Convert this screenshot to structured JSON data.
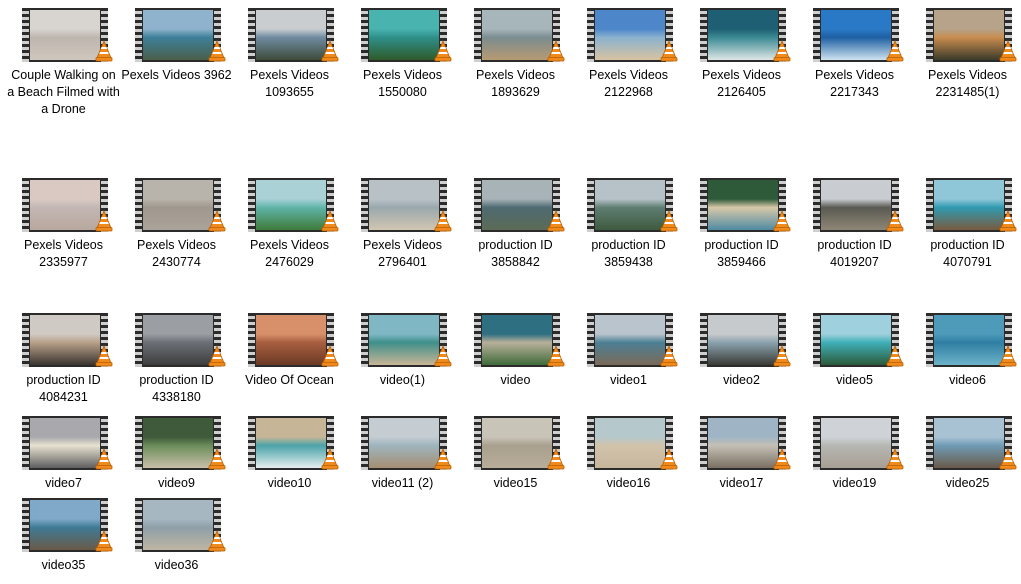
{
  "files": [
    {
      "name": "Couple Walking on a Beach Filmed with a Drone",
      "icon": "video-file-icon",
      "sky": "#d8d4cf",
      "mid": "#bdb6ae",
      "ground": "#cfc7bd"
    },
    {
      "name": "Pexels Videos 3962",
      "icon": "video-file-icon",
      "sky": "#8fb3cc",
      "mid": "#3d7f99",
      "ground": "#4a5f4a"
    },
    {
      "name": "Pexels Videos 1093655",
      "icon": "video-file-icon",
      "sky": "#c9cdd0",
      "mid": "#6f8aa0",
      "ground": "#3e4b3a"
    },
    {
      "name": "Pexels Videos 1550080",
      "icon": "video-file-icon",
      "sky": "#49b3b0",
      "mid": "#2f8f8a",
      "ground": "#2f5a2a"
    },
    {
      "name": "Pexels Videos 1893629",
      "icon": "video-file-icon",
      "sky": "#a7b6bb",
      "mid": "#7b8c90",
      "ground": "#b79a72"
    },
    {
      "name": "Pexels Videos 2122968",
      "icon": "video-file-icon",
      "sky": "#4d86c9",
      "mid": "#8ab2cf",
      "ground": "#d8c3a0"
    },
    {
      "name": "Pexels Videos 2126405",
      "icon": "video-file-icon",
      "sky": "#1f5f73",
      "mid": "#3b8a93",
      "ground": "#dfe6e6"
    },
    {
      "name": "Pexels Videos 2217343",
      "icon": "video-file-icon",
      "sky": "#2a79c6",
      "mid": "#1e5fa3",
      "ground": "#cfe3f0"
    },
    {
      "name": "Pexels Videos 2231485(1)",
      "icon": "video-file-icon",
      "sky": "#b6a38a",
      "mid": "#c88c4e",
      "ground": "#3b3a2a"
    },
    {
      "name": "Pexels Videos 2335977",
      "icon": "video-file-icon",
      "sky": "#d9c9c2",
      "mid": "#c3b7b4",
      "ground": "#b8a79e"
    },
    {
      "name": "Pexels Videos 2430774",
      "icon": "video-file-icon",
      "sky": "#b9b4ab",
      "mid": "#9f988e",
      "ground": "#aaa39a"
    },
    {
      "name": "Pexels Videos 2476029",
      "icon": "video-file-icon",
      "sky": "#a9d1d6",
      "mid": "#5fb4a8",
      "ground": "#3f7a3a"
    },
    {
      "name": "Pexels Videos 2796401",
      "icon": "video-file-icon",
      "sky": "#b8c2c6",
      "mid": "#9aa8ad",
      "ground": "#d2c6b2"
    },
    {
      "name": "production ID 3858842",
      "icon": "video-file-icon",
      "sky": "#a8b3b8",
      "mid": "#4e6a72",
      "ground": "#5b6b55"
    },
    {
      "name": "production ID 3859438",
      "icon": "video-file-icon",
      "sky": "#b6c2c8",
      "mid": "#5e7e72",
      "ground": "#3e5a3e"
    },
    {
      "name": "production ID 3859466",
      "icon": "video-file-icon",
      "sky": "#2e5a3a",
      "mid": "#d7c8a8",
      "ground": "#4f8aa3"
    },
    {
      "name": "production ID 4019207",
      "icon": "video-file-icon",
      "sky": "#c9ccd0",
      "mid": "#5a5a52",
      "ground": "#8f8676"
    },
    {
      "name": "production ID 4070791",
      "icon": "video-file-icon",
      "sky": "#8fc7d8",
      "mid": "#2f9ab0",
      "ground": "#7a5a3e"
    },
    {
      "name": "production ID 4084231",
      "icon": "video-file-icon",
      "sky": "#cfcbc4",
      "mid": "#b8a089",
      "ground": "#3a3530"
    },
    {
      "name": "production ID 4338180",
      "icon": "video-file-icon",
      "sky": "#9b9ea3",
      "mid": "#6b6f75",
      "ground": "#3d3d3d"
    },
    {
      "name": "Video Of Ocean",
      "icon": "video-file-icon",
      "sky": "#d8906a",
      "mid": "#a85e3f",
      "ground": "#6b3a26"
    },
    {
      "name": "video(1)",
      "icon": "video-file-icon",
      "sky": "#7fb8c4",
      "mid": "#3e8f8a",
      "ground": "#c8b596"
    },
    {
      "name": "video",
      "icon": "video-file-icon",
      "sky": "#2e6f82",
      "mid": "#b9b09a",
      "ground": "#3f6b3a"
    },
    {
      "name": "video1",
      "icon": "video-file-icon",
      "sky": "#b9c4cc",
      "mid": "#4c7f95",
      "ground": "#7a6a58"
    },
    {
      "name": "video2",
      "icon": "video-file-icon",
      "sky": "#c7cacc",
      "mid": "#8aa2ae",
      "ground": "#3b3b36"
    },
    {
      "name": "video5",
      "icon": "video-file-icon",
      "sky": "#9fd0dd",
      "mid": "#3fb0b8",
      "ground": "#2c5a3a"
    },
    {
      "name": "video6",
      "icon": "video-file-icon",
      "sky": "#4d9ab9",
      "mid": "#2f7ea3",
      "ground": "#6db3c9"
    },
    {
      "name": "video7",
      "icon": "video-file-icon",
      "sky": "#a9a9ad",
      "mid": "#e7e2d0",
      "ground": "#5e5e60"
    },
    {
      "name": "video9",
      "icon": "video-file-icon",
      "sky": "#3e5a3a",
      "mid": "#6b8c5a",
      "ground": "#c9c0a9"
    },
    {
      "name": "video10",
      "icon": "video-file-icon",
      "sky": "#c7b597",
      "mid": "#4aa3a8",
      "ground": "#e6eef0"
    },
    {
      "name": "video11 (2)",
      "icon": "video-file-icon",
      "sky": "#c5ccd2",
      "mid": "#9eb4bd",
      "ground": "#a68f73"
    },
    {
      "name": "video15",
      "icon": "video-file-icon",
      "sky": "#c9c4b8",
      "mid": "#a99f8e",
      "ground": "#b8ad99"
    },
    {
      "name": "video16",
      "icon": "video-file-icon",
      "sky": "#b5c8cc",
      "mid": "#d2c3ab",
      "ground": "#c5b69c"
    },
    {
      "name": "video17",
      "icon": "video-file-icon",
      "sky": "#9fb4c4",
      "mid": "#c4c0b6",
      "ground": "#7a6f62"
    },
    {
      "name": "video19",
      "icon": "video-file-icon",
      "sky": "#cfd3d8",
      "mid": "#b6b7b3",
      "ground": "#a89f94"
    },
    {
      "name": "video25",
      "icon": "video-file-icon",
      "sky": "#a8c2d4",
      "mid": "#6f9bb5",
      "ground": "#6a5a4a"
    },
    {
      "name": "video35",
      "icon": "video-file-icon",
      "sky": "#7fa8c9",
      "mid": "#3f7a95",
      "ground": "#6b5a48"
    },
    {
      "name": "video36",
      "icon": "video-file-icon",
      "sky": "#a6b7c2",
      "mid": "#8f9fa8",
      "ground": "#bfb5a4"
    }
  ]
}
